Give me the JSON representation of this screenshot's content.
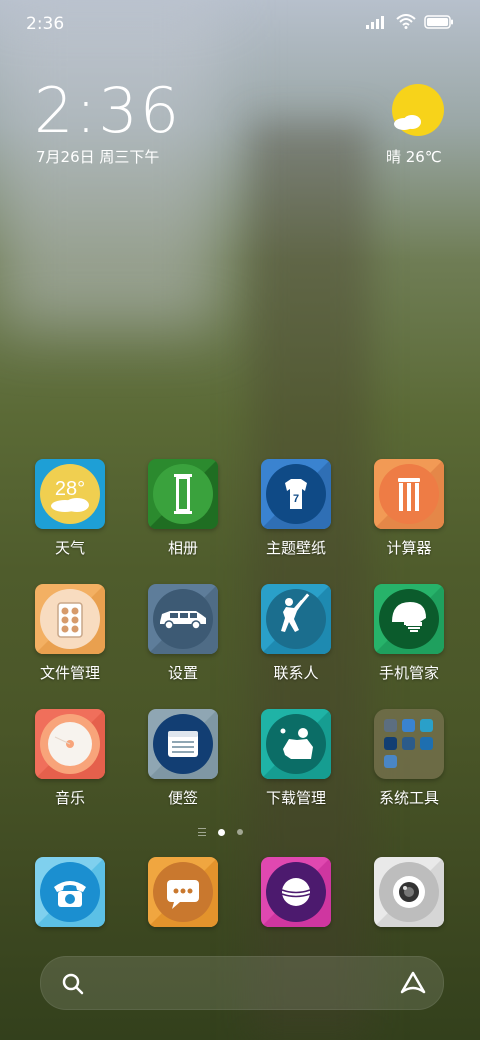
{
  "status_bar": {
    "time": "2:36"
  },
  "clock_widget": {
    "time": "2:36",
    "date": "7月26日 周三下午"
  },
  "weather_widget": {
    "text": "晴 26℃"
  },
  "apps": [
    {
      "label": "天气",
      "icon": "weather-icon",
      "badge": "28°"
    },
    {
      "label": "相册",
      "icon": "gallery-icon"
    },
    {
      "label": "主题壁纸",
      "icon": "jersey-icon",
      "badge": "7"
    },
    {
      "label": "计算器",
      "icon": "wickets-icon"
    },
    {
      "label": "文件管理",
      "icon": "file-manager-icon"
    },
    {
      "label": "设置",
      "icon": "jeep-icon"
    },
    {
      "label": "联系人",
      "icon": "batsman-icon"
    },
    {
      "label": "手机管家",
      "icon": "helmet-icon"
    },
    {
      "label": "音乐",
      "icon": "music-disc-icon"
    },
    {
      "label": "便签",
      "icon": "notes-icon"
    },
    {
      "label": "下载管理",
      "icon": "fielder-icon"
    },
    {
      "label": "系统工具",
      "icon": "folder-icon"
    }
  ],
  "dock": [
    {
      "icon": "phone-icon"
    },
    {
      "icon": "messages-icon"
    },
    {
      "icon": "cricket-ball-icon"
    },
    {
      "icon": "camera-icon"
    }
  ],
  "page_indicator": {
    "pages": 2,
    "current": 1
  },
  "colors": {
    "accent_sun": "#f7d31a",
    "label_text": "#ffffff"
  }
}
